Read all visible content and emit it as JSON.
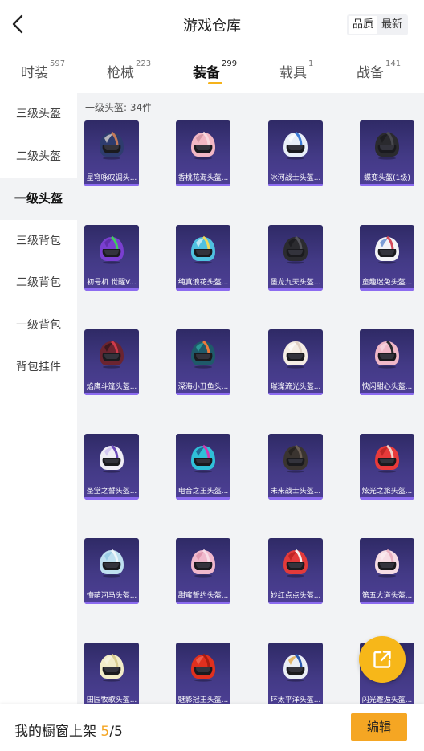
{
  "header": {
    "title": "游戏仓库",
    "back_icon": "chevron-left-icon",
    "sort_options": [
      {
        "label": "品质",
        "active": true
      },
      {
        "label": "最新",
        "active": false
      }
    ]
  },
  "tabs": [
    {
      "label": "时装",
      "count": "597",
      "active": false
    },
    {
      "label": "枪械",
      "count": "223",
      "active": false
    },
    {
      "label": "装备",
      "count": "299",
      "active": true
    },
    {
      "label": "载具",
      "count": "1",
      "active": false
    },
    {
      "label": "战备",
      "count": "141",
      "active": false
    }
  ],
  "sidebar": {
    "items": [
      {
        "label": "三级头盔",
        "active": false
      },
      {
        "label": "二级头盔",
        "active": false
      },
      {
        "label": "一级头盔",
        "active": true
      },
      {
        "label": "三级背包",
        "active": false
      },
      {
        "label": "二级背包",
        "active": false
      },
      {
        "label": "一级背包",
        "active": false
      },
      {
        "label": "背包挂件",
        "active": false
      }
    ]
  },
  "section": {
    "label": "一级头盔: 34件"
  },
  "items": [
    {
      "name": "星穹咏叹调头...",
      "colors": [
        "#2e3c6e",
        "#c47a5a",
        "#f0e6dc"
      ]
    },
    {
      "name": "香桃花海头盔...",
      "colors": [
        "#f2b7c4",
        "#f7d8de",
        "#c98a98"
      ]
    },
    {
      "name": "冰河战士头盔...",
      "colors": [
        "#e8eef8",
        "#3b7bd6",
        "#ffffff"
      ]
    },
    {
      "name": "蝶变头盔(1级)",
      "colors": [
        "#2a2a2e",
        "#4a4a50",
        "#1a1a1d"
      ]
    },
    {
      "name": "初号机 觉醒V...",
      "colors": [
        "#7a3fd0",
        "#3fcf5a",
        "#5a2aa0"
      ]
    },
    {
      "name": "纯真浪花头盔...",
      "colors": [
        "#4fc1e0",
        "#f0d85a",
        "#e8f6fb"
      ]
    },
    {
      "name": "墨龙九天头盔...",
      "colors": [
        "#2b2b2f",
        "#55555c",
        "#18181b"
      ]
    },
    {
      "name": "童趣迷兔头盔...",
      "colors": [
        "#f3f3f6",
        "#d44a5a",
        "#4a78c8"
      ]
    },
    {
      "name": "焰鹰斗篷头盔...",
      "colors": [
        "#6b2430",
        "#d03a4a",
        "#2a1418"
      ]
    },
    {
      "name": "深海小丑鱼头...",
      "colors": [
        "#1f5a6a",
        "#ef7a3a",
        "#2fb0a8"
      ]
    },
    {
      "name": "璀璨流光头盔...",
      "colors": [
        "#f4ece4",
        "#e0d0c4",
        "#ffffff"
      ]
    },
    {
      "name": "快闪甜心头盔...",
      "colors": [
        "#f0b8c8",
        "#2a2a2e",
        "#f8dce4"
      ]
    },
    {
      "name": "圣堂之誓头盔...",
      "colors": [
        "#f0eef6",
        "#6a4ab8",
        "#c8b8f0"
      ]
    },
    {
      "name": "电音之王头盔...",
      "colors": [
        "#2fc0d8",
        "#d03ab0",
        "#1a4a80"
      ]
    },
    {
      "name": "未来战士头盔...",
      "colors": [
        "#3a3430",
        "#6a5e54",
        "#201c1a"
      ]
    },
    {
      "name": "炫光之旅头盔...",
      "colors": [
        "#e83a3a",
        "#f0d0c8",
        "#b02020"
      ]
    },
    {
      "name": "懵萌河马头盔...",
      "colors": [
        "#bfe0f0",
        "#eef6fa",
        "#8cc4e0"
      ]
    },
    {
      "name": "甜蜜誓约头盔...",
      "colors": [
        "#f0b8cc",
        "#f8dce6",
        "#d88aa4"
      ]
    },
    {
      "name": "妙红点点头盔...",
      "colors": [
        "#e23a3a",
        "#f6f0ee",
        "#b01c1c"
      ]
    },
    {
      "name": "第五大道头盔...",
      "colors": [
        "#f6dce4",
        "#e8b0c0",
        "#fbeef2"
      ]
    },
    {
      "name": "田园牧歌头盔...",
      "colors": [
        "#f2ecc8",
        "#d8cc90",
        "#faf6e4"
      ]
    },
    {
      "name": "魅影冠王头盔...",
      "colors": [
        "#e0301e",
        "#a81c10",
        "#f07060"
      ]
    },
    {
      "name": "环太平洋头盔...",
      "colors": [
        "#eaeef6",
        "#2a5ab0",
        "#e0a030"
      ]
    },
    {
      "name": "闪光邂逅头盔...",
      "colors": [
        "#f0e8f0",
        "#b8a0d8",
        "#ffffff"
      ]
    }
  ],
  "share_button": {
    "icon": "share-external-icon",
    "color": "#f7b719"
  },
  "bottom_bar": {
    "shelf_label": "我的橱窗上架",
    "shelf_current": "5",
    "shelf_total": "/5",
    "edit_label": "编辑",
    "accent": "#f5a623"
  }
}
